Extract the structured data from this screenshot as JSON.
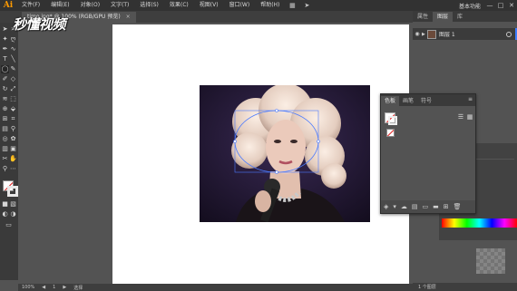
{
  "menubar": {
    "logo": "Ai",
    "items": [
      "文件(F)",
      "编辑(E)",
      "对象(O)",
      "文字(T)",
      "选择(S)",
      "效果(C)",
      "视图(V)",
      "窗口(W)",
      "帮助(H)"
    ],
    "workspace": "基本功能",
    "window_controls": [
      "—",
      "□",
      "✕"
    ]
  },
  "document": {
    "tab_label": "timo.jpg* @ 100% (RGB/GPU 预览)",
    "close": "×"
  },
  "watermark": "秒懂视频",
  "right_panel": {
    "tabs": [
      "属性",
      "图层",
      "库"
    ],
    "layer": {
      "name": "图层 1"
    },
    "footer": "1 个图层"
  },
  "color_panel": {
    "tabs": [
      "色板",
      "画笔",
      "符号"
    ],
    "menu_icon": "≡"
  },
  "statusbar": {
    "zoom": "100%",
    "page": "1",
    "tool": "选择"
  },
  "colors": {
    "accent": "#ff9a00",
    "layer_color": "#3c7cff",
    "none_slash": "#e02020"
  }
}
